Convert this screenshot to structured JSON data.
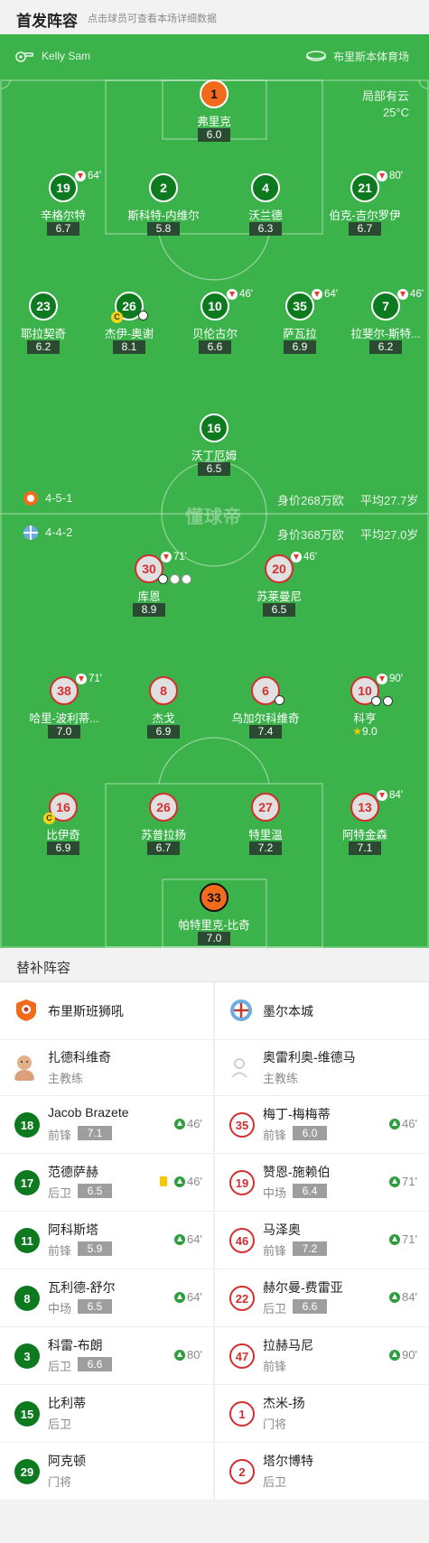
{
  "header": {
    "title": "首发阵容",
    "subtitle": "点击球员可查看本场详细数据"
  },
  "match": {
    "referee": "Kelly Sam",
    "venue": "布里斯本体育场",
    "weather": "局部有云",
    "temperature": "25°C",
    "watermark": "懂球帝"
  },
  "home_team": {
    "name": "布里斯班狮吼",
    "formation": "4-5-1",
    "value": "身价268万欧",
    "avg_age": "平均27.7岁",
    "color": "#0d7a1f"
  },
  "away_team": {
    "name": "墨尔本城",
    "formation": "4-4-2",
    "value": "身价368万欧",
    "avg_age": "平均27.0岁",
    "color": "#d32f2f"
  },
  "home_lineup": [
    {
      "num": "1",
      "name": "弗里克",
      "rating": "6.0"
    },
    {
      "num": "19",
      "name": "辛格尔特",
      "rating": "6.7",
      "sub": "64'"
    },
    {
      "num": "2",
      "name": "斯科特-内维尔",
      "rating": "5.8"
    },
    {
      "num": "4",
      "name": "沃兰德",
      "rating": "6.3"
    },
    {
      "num": "21",
      "name": "伯克-吉尔罗伊",
      "rating": "6.7",
      "sub": "80'"
    },
    {
      "num": "23",
      "name": "耶拉契奇",
      "rating": "6.2"
    },
    {
      "num": "26",
      "name": "杰伊-奥谢",
      "rating": "8.1"
    },
    {
      "num": "10",
      "name": "贝伦古尔",
      "rating": "6.6",
      "sub": "46'"
    },
    {
      "num": "35",
      "name": "萨瓦拉",
      "rating": "6.9",
      "sub": "64'"
    },
    {
      "num": "7",
      "name": "拉斐尔-斯特...",
      "rating": "6.2",
      "sub": "46'"
    },
    {
      "num": "16",
      "name": "沃丁厄姆",
      "rating": "6.5"
    }
  ],
  "away_lineup": [
    {
      "num": "30",
      "name": "库恩",
      "rating": "8.9",
      "sub": "71'"
    },
    {
      "num": "20",
      "name": "苏莱曼尼",
      "rating": "6.5",
      "sub": "46'"
    },
    {
      "num": "38",
      "name": "哈里-波利蒂...",
      "rating": "7.0",
      "sub": "71'"
    },
    {
      "num": "8",
      "name": "杰戈",
      "rating": "6.9"
    },
    {
      "num": "6",
      "name": "乌加尔科维奇",
      "rating": "7.4"
    },
    {
      "num": "10",
      "name": "科亨",
      "rating": "9.0",
      "sub": "90'"
    },
    {
      "num": "16",
      "name": "比伊奇",
      "rating": "6.9"
    },
    {
      "num": "26",
      "name": "苏普拉扬",
      "rating": "6.7"
    },
    {
      "num": "27",
      "name": "特里温",
      "rating": "7.2"
    },
    {
      "num": "13",
      "name": "阿特金森",
      "rating": "7.1",
      "sub": "84'"
    },
    {
      "num": "33",
      "name": "帕特里克-比奇",
      "rating": "7.0"
    }
  ],
  "subs": {
    "title": "替补阵容",
    "home_coach": {
      "name": "扎德科维奇",
      "role": "主教练"
    },
    "away_coach": {
      "name": "奥雷利奥-维德马",
      "role": "主教练"
    },
    "home": [
      {
        "num": "18",
        "name": "Jacob Brazete",
        "pos": "前锋",
        "rating": "7.1",
        "min": "46'"
      },
      {
        "num": "17",
        "name": "范德萨赫",
        "pos": "后卫",
        "rating": "6.5",
        "min": "46'"
      },
      {
        "num": "11",
        "name": "阿科斯塔",
        "pos": "前锋",
        "rating": "5.9",
        "min": "64'"
      },
      {
        "num": "8",
        "name": "瓦利德-舒尔",
        "pos": "中场",
        "rating": "6.5",
        "min": "64'"
      },
      {
        "num": "3",
        "name": "科雷-布朗",
        "pos": "后卫",
        "rating": "6.6",
        "min": "80'"
      },
      {
        "num": "15",
        "name": "比利蒂",
        "pos": "后卫"
      },
      {
        "num": "29",
        "name": "阿克顿",
        "pos": "门将"
      }
    ],
    "away": [
      {
        "num": "35",
        "name": "梅丁-梅梅蒂",
        "pos": "前锋",
        "rating": "6.0",
        "min": "46'"
      },
      {
        "num": "19",
        "name": "赞恩-施赖伯",
        "pos": "中场",
        "rating": "6.4",
        "min": "71'"
      },
      {
        "num": "46",
        "name": "马泽奥",
        "pos": "前锋",
        "rating": "7.2",
        "min": "71'"
      },
      {
        "num": "22",
        "name": "赫尔曼-费雷亚",
        "pos": "后卫",
        "rating": "6.6",
        "min": "84'"
      },
      {
        "num": "47",
        "name": "拉赫马尼",
        "pos": "前锋",
        "min": "90'"
      },
      {
        "num": "1",
        "name": "杰米-扬",
        "pos": "门将"
      },
      {
        "num": "2",
        "name": "塔尔博特",
        "pos": "后卫"
      }
    ]
  }
}
